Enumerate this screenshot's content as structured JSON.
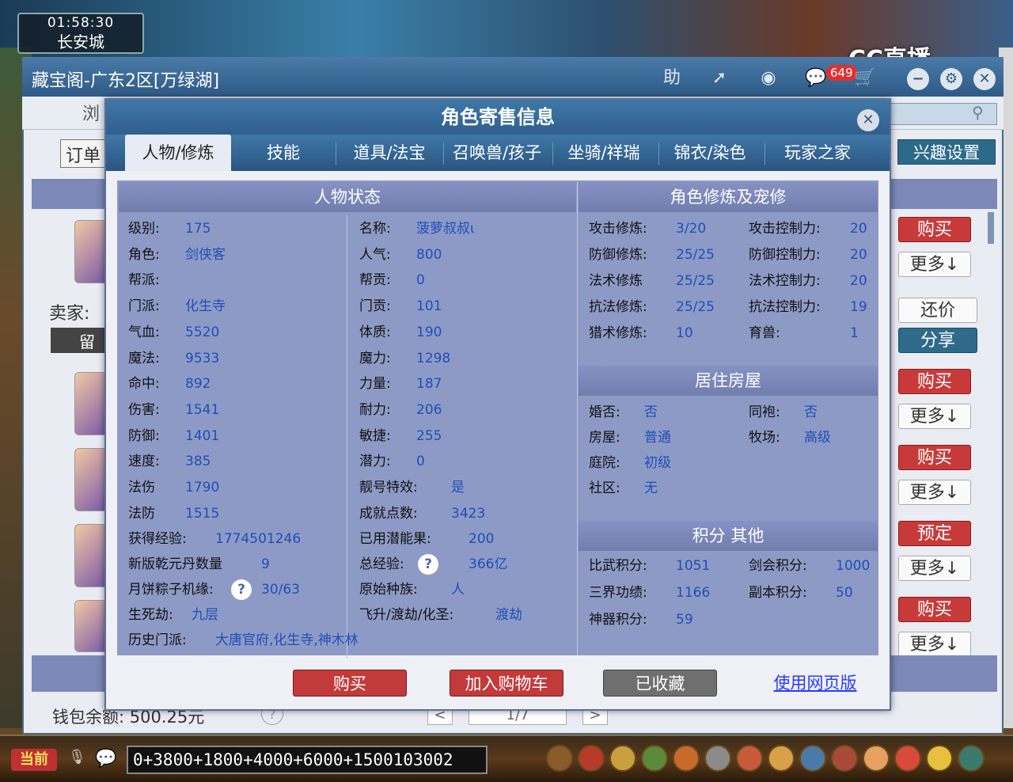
{
  "game": {
    "clock": "01:58:30",
    "city": "长安城",
    "watermark": "CC直播",
    "chat_channel_label": "当前",
    "chat_input": "0+3800+1800+4000+6000+1500103002"
  },
  "window": {
    "title": "藏宝阁-广东2区[万绿湖]",
    "toolbar": {
      "help_label": "助",
      "msg_count": "649"
    },
    "nav_partial": "浏",
    "order_button": "订单",
    "interest_button": "兴趣设置",
    "seller_label": "卖家:",
    "leave_msg_button": "留言",
    "wallet_text": "钱包余额: 500.25元",
    "wallet_help": "?",
    "pager": {
      "prev": "<",
      "page": "1/7",
      "next": ">"
    },
    "listing_buttons": [
      {
        "primary": "购买",
        "secondary": "更多↓",
        "tertiary": "还价",
        "share": "分享"
      },
      {
        "primary": "购买",
        "secondary": "更多↓"
      },
      {
        "primary": "购买",
        "secondary": "更多↓"
      },
      {
        "primary": "预定",
        "secondary": "更多↓"
      },
      {
        "primary": "购买",
        "secondary": "更多↓"
      }
    ]
  },
  "modal": {
    "title": "角色寄售信息",
    "close": "✕",
    "tabs": [
      "人物/修炼",
      "技能",
      "道具/法宝",
      "召唤兽/孩子",
      "坐骑/祥瑞",
      "锦衣/染色",
      "玩家之家"
    ],
    "active_tab": 0,
    "status": {
      "header": "人物状态",
      "left": [
        {
          "label": "级别:",
          "value": "175"
        },
        {
          "label": "角色:",
          "value": "剑侠客"
        },
        {
          "label": "帮派:",
          "value": ""
        },
        {
          "label": "门派:",
          "value": "化生寺"
        },
        {
          "label": "气血:",
          "value": "5520"
        },
        {
          "label": "魔法:",
          "value": "9533"
        },
        {
          "label": "命中:",
          "value": "892"
        },
        {
          "label": "伤害:",
          "value": "1541"
        },
        {
          "label": "防御:",
          "value": "1401"
        },
        {
          "label": "速度:",
          "value": "385"
        },
        {
          "label": "法伤",
          "value": "1790"
        },
        {
          "label": "法防",
          "value": "1515"
        }
      ],
      "right": [
        {
          "label": "名称:",
          "value": "菠萝叔叔ι"
        },
        {
          "label": "人气:",
          "value": "800"
        },
        {
          "label": "帮贡:",
          "value": "0"
        },
        {
          "label": "门贡:",
          "value": "101"
        },
        {
          "label": "体质:",
          "value": "190"
        },
        {
          "label": "魔力:",
          "value": "1298"
        },
        {
          "label": "力量:",
          "value": "187"
        },
        {
          "label": "耐力:",
          "value": "206"
        },
        {
          "label": "敏捷:",
          "value": "255"
        },
        {
          "label": "潜力:",
          "value": "0"
        },
        {
          "label": "靓号特效:",
          "value": "是"
        },
        {
          "label": "成就点数:",
          "value": "3423"
        }
      ],
      "extra": [
        {
          "label": "获得经验:",
          "value": "1774501246",
          "label2": "已用潜能果:",
          "value2": "200"
        },
        {
          "label": "新版乾元丹数量",
          "value": "9",
          "label2": "总经验:",
          "value2": "366亿",
          "help2": "?"
        },
        {
          "label": "月饼粽子机缘:",
          "value": "30/63",
          "help": "?",
          "label2": "原始种族:",
          "value2": "人"
        },
        {
          "label": "生死劫:",
          "value": "九层",
          "label2": "飞升/渡劫/化圣:",
          "value2": "渡劫"
        },
        {
          "label": "历史门派:",
          "value": "大唐官府,化生寺,神木林"
        }
      ]
    },
    "cultivation": {
      "header": "角色修炼及宠修",
      "rows": [
        {
          "l1": "攻击修炼:",
          "v1": "3/20",
          "l2": "攻击控制力:",
          "v2": "20"
        },
        {
          "l1": "防御修炼:",
          "v1": "25/25",
          "l2": "防御控制力:",
          "v2": "20"
        },
        {
          "l1": "法术修炼",
          "v1": "25/25",
          "l2": "法术控制力:",
          "v2": "20"
        },
        {
          "l1": "抗法修炼:",
          "v1": "25/25",
          "l2": "抗法控制力:",
          "v2": "19"
        },
        {
          "l1": "猎术修炼:",
          "v1": "10",
          "l2": "育兽:",
          "v2": "1"
        }
      ]
    },
    "house": {
      "header": "居住房屋",
      "rows": [
        {
          "l1": "婚否:",
          "v1": "否",
          "l2": "同袍:",
          "v2": "否"
        },
        {
          "l1": "房屋:",
          "v1": "普通",
          "l2": "牧场:",
          "v2": "高级"
        },
        {
          "l1": "庭院:",
          "v1": "初级",
          "l2": "",
          "v2": ""
        },
        {
          "l1": "社区:",
          "v1": "无",
          "l2": "",
          "v2": ""
        }
      ]
    },
    "score": {
      "header": "积分 其他",
      "rows": [
        {
          "l1": "比武积分:",
          "v1": "1051",
          "l2": "剑会积分:",
          "v2": "1000"
        },
        {
          "l1": "三界功绩:",
          "v1": "1166",
          "l2": "副本积分:",
          "v2": "50"
        },
        {
          "l1": "神器积分:",
          "v1": "59",
          "l2": "",
          "v2": ""
        }
      ]
    },
    "buttons": {
      "buy": "购买",
      "cart": "加入购物车",
      "favorited": "已收藏",
      "web": "使用网页版"
    }
  },
  "icons": [
    "clock-icon",
    "help-icon",
    "share-icon",
    "record-icon",
    "chat-icon",
    "cart-icon",
    "minimize-icon",
    "settings-icon",
    "close-icon",
    "search-icon",
    "mic-icon"
  ]
}
